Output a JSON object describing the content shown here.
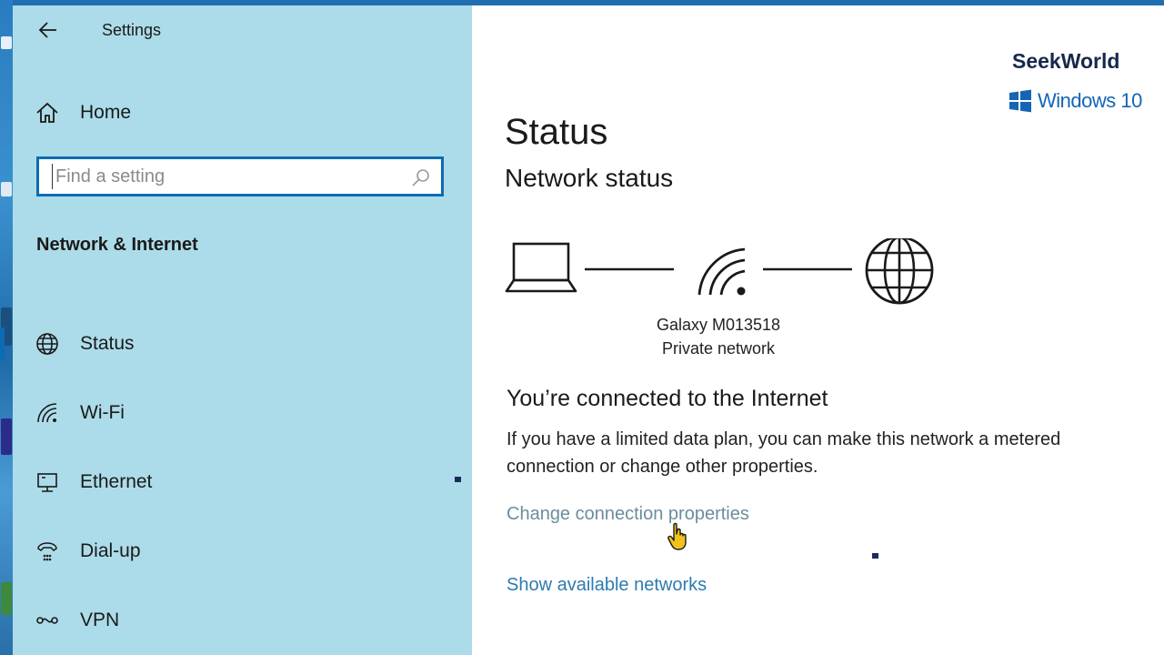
{
  "window": {
    "title": "Settings"
  },
  "sidebar": {
    "home_label": "Home",
    "search": {
      "placeholder": "Find a setting",
      "value": ""
    },
    "section_title": "Network & Internet",
    "items": [
      {
        "label": "Status",
        "icon": "globe-icon",
        "active": true
      },
      {
        "label": "Wi-Fi",
        "icon": "wifi-icon",
        "active": false
      },
      {
        "label": "Ethernet",
        "icon": "ethernet-icon",
        "active": false
      },
      {
        "label": "Dial-up",
        "icon": "dialup-icon",
        "active": false
      },
      {
        "label": "VPN",
        "icon": "vpn-icon",
        "active": false
      }
    ]
  },
  "main": {
    "page_title": "Status",
    "network_status_title": "Network status",
    "network": {
      "name": "Galaxy M013518",
      "type": "Private network"
    },
    "connection_title": "You’re connected to the Internet",
    "connection_desc": "If you have a limited data plan, you can make this network a metered connection or change other properties.",
    "links": {
      "change_properties": "Change connection properties",
      "show_networks": "Show available networks"
    }
  },
  "watermark": {
    "brand": "SeekWorld",
    "os_label": "Windows 10"
  },
  "colors": {
    "sidebar_bg": "#acdce9",
    "accent": "#0b6cb4",
    "link": "#2d7bb0",
    "brand": "#17284d",
    "windows_blue": "#1565b5"
  }
}
